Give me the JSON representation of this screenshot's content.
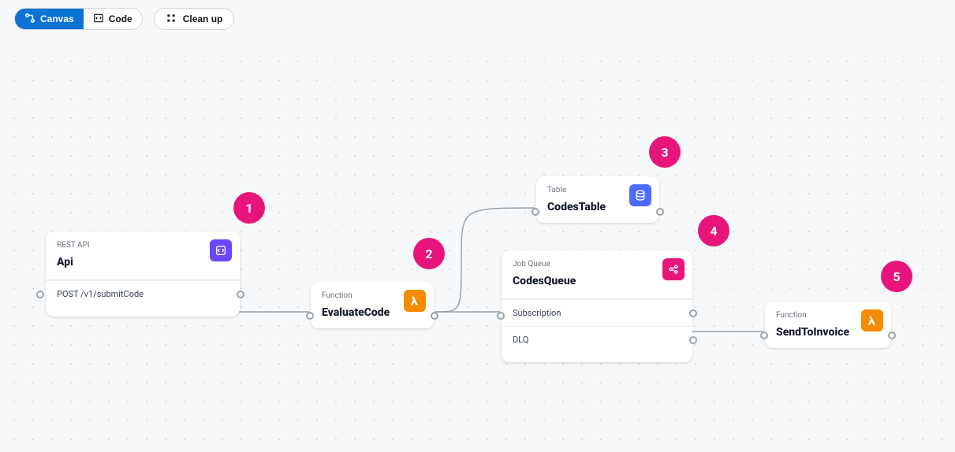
{
  "toolbar": {
    "canvas_label": "Canvas",
    "code_label": "Code",
    "cleanup_label": "Clean up"
  },
  "badges": {
    "b1": "1",
    "b2": "2",
    "b3": "3",
    "b4": "4",
    "b5": "5"
  },
  "nodes": {
    "api": {
      "type": "REST API",
      "title": "Api",
      "route": "POST /v1/submitCode"
    },
    "evaluate": {
      "type": "Function",
      "title": "EvaluateCode"
    },
    "table": {
      "type": "Table",
      "title": "CodesTable"
    },
    "queue": {
      "type": "Job Queue",
      "title": "CodesQueue",
      "subscription": "Subscription",
      "dlq": "DLQ"
    },
    "invoice": {
      "type": "Function",
      "title": "SendToInvoice"
    }
  },
  "icons": {
    "canvas": "canvas-icon",
    "code": "code-icon",
    "cleanup": "cleanup-icon",
    "api": "api-gateway-icon",
    "lambda": "lambda-icon",
    "dynamodb": "dynamodb-icon",
    "sns": "sns-icon"
  },
  "colors": {
    "primary": "#0972d3",
    "badge": "#e7157b",
    "lambda": "#f58b00",
    "api": "#6c47ff",
    "dynamodb": "#4b6cff"
  }
}
